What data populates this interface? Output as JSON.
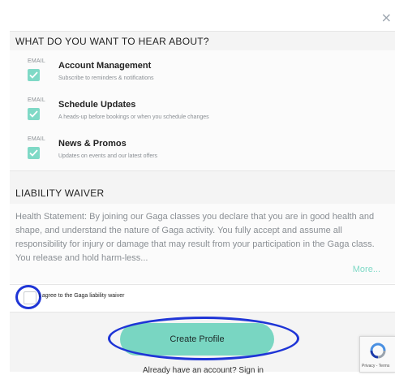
{
  "dialog": {
    "close_glyph": "×"
  },
  "preferences": {
    "heading": "WHAT DO YOU WANT TO HEAR ABOUT?",
    "items": [
      {
        "tag": "EMAIL",
        "title": "Account Management",
        "subtitle": "Subscribe to reminders & notifications",
        "checked": true
      },
      {
        "tag": "EMAIL",
        "title": "Schedule Updates",
        "subtitle": "A heads-up before bookings or when you schedule changes",
        "checked": true
      },
      {
        "tag": "EMAIL",
        "title": "News & Promos",
        "subtitle": "Updates on events and our latest offers",
        "checked": true
      }
    ]
  },
  "waiver": {
    "heading": "LIABILITY WAIVER",
    "text": "Health Statement: By joining our Gaga classes you declare that you are in good health and shape, and understand the nature of Gaga activity. You fully accept and assume all responsibility for injury or damage that may result from your participation in the Gaga class. You release and hold harm-less...",
    "more_label": "More...",
    "agree_label": "I agree to the Gaga liability waiver",
    "agree_checked": false
  },
  "actions": {
    "create_label": "Create Profile",
    "signin_text": "Already have an account? Sign in"
  },
  "recaptcha": {
    "footer": "Privacy - Terms"
  },
  "colors": {
    "accent": "#79d6c2",
    "highlight_ring": "#1f35d6",
    "band": "#f4f4f4"
  }
}
